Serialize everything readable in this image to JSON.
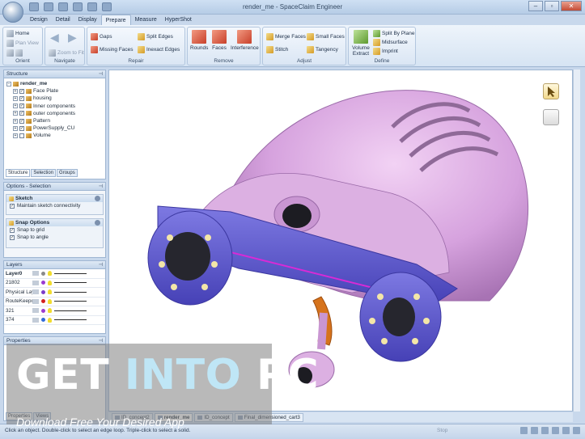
{
  "window": {
    "title": "render_me - SpaceClaim Engineer",
    "controls": [
      "–",
      "▫",
      "✕"
    ]
  },
  "ribbon_tabs": [
    {
      "label": "Design",
      "active": false
    },
    {
      "label": "Detail",
      "active": false
    },
    {
      "label": "Display",
      "active": false
    },
    {
      "label": "Prepare",
      "active": true
    },
    {
      "label": "Measure",
      "active": false
    },
    {
      "label": "HyperShot",
      "active": false
    }
  ],
  "ribbon": {
    "orient": {
      "title": "Orient",
      "home": "Home",
      "plan_view": "Plan View"
    },
    "navigate": {
      "title": "Navigate",
      "zoom_to_fit": "Zoom to Fit"
    },
    "repair": {
      "title": "Repair",
      "gaps": "Gaps",
      "split_edges": "Split Edges",
      "missing_faces": "Missing Faces",
      "inexact_edges": "Inexact Edges"
    },
    "remove": {
      "title": "Remove",
      "rounds": "Rounds",
      "faces": "Faces",
      "interference": "Interference"
    },
    "adjust": {
      "title": "Adjust",
      "merge_faces": "Merge Faces",
      "small_faces": "Small Faces",
      "stitch": "Stitch",
      "tangency": "Tangency"
    },
    "define": {
      "title": "Define",
      "volume_extract": "Volume Extract",
      "split_by_plane": "Split By Plane",
      "midsurface": "Midsurface",
      "imprint": "Imprint"
    }
  },
  "structure": {
    "title": "Structure",
    "root": "render_me",
    "items": [
      "Face Plate",
      "housing",
      "Inner components",
      "outer components",
      "Pattern",
      "PowerSupply_CU",
      "Volume"
    ],
    "tabs": [
      "Structure",
      "Selection",
      "Groups"
    ]
  },
  "options": {
    "title": "Options - Selection",
    "sketch_title": "Sketch",
    "sketch_items": [
      "Maintain sketch connectivity"
    ],
    "snap_title": "Snap Options",
    "snap_items": [
      "Snap to grid",
      "Snap to angle"
    ]
  },
  "layers": {
    "title": "Layers",
    "rows": [
      {
        "name": "Layer0",
        "color": "#8a8a8a"
      },
      {
        "name": "21802",
        "color": "#9b3bd1"
      },
      {
        "name": "Physical Lay...",
        "color": "#7c3bc9"
      },
      {
        "name": "RouteKeepout",
        "color": "#d42020"
      },
      {
        "name": "321",
        "color": "#9b3bd1"
      },
      {
        "name": "374",
        "color": "#2f6bd9"
      }
    ]
  },
  "properties": {
    "title": "Properties",
    "tabs": [
      "Properties",
      "Views"
    ]
  },
  "doc_tabs": [
    {
      "label": "ID_concept2",
      "active": false
    },
    {
      "label": "render_me",
      "active": true
    },
    {
      "label": "ID_concept",
      "active": false
    },
    {
      "label": "Final_dimensioned_cart3",
      "active": false
    }
  ],
  "status": {
    "hint": "Click an object. Double-click to select an edge loop. Triple-click to select a solid.",
    "stop": "Stop"
  },
  "watermark": {
    "line1_a": "GET ",
    "line1_b": "INTO ",
    "line1_c": "PC",
    "line2": "Download Free Your Desired App"
  }
}
